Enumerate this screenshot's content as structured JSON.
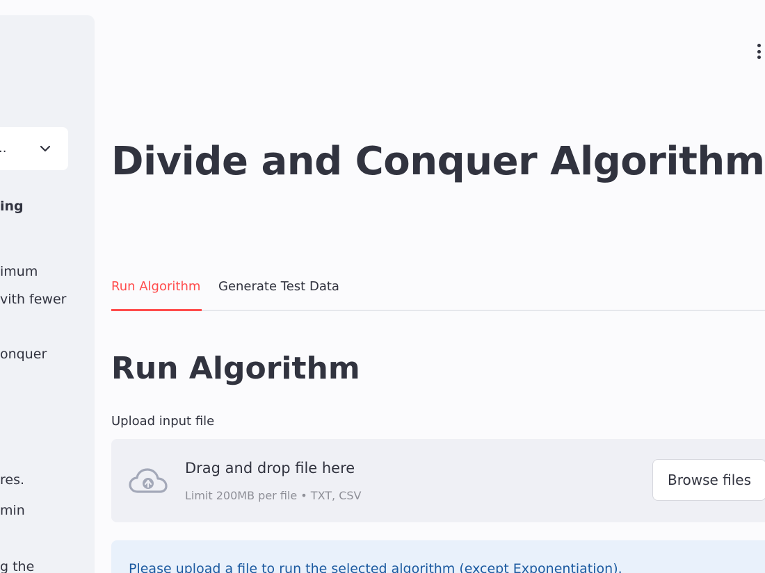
{
  "sidebar": {
    "select_value": "..",
    "fragments": [
      "ing",
      "imum",
      "vith fewer",
      "onquer",
      "res.",
      "min",
      "g the"
    ]
  },
  "header": {
    "menu_icon": "vertical-dots-icon"
  },
  "main": {
    "title": "Divide and Conquer Algorithms",
    "tabs": [
      {
        "label": "Run Algorithm",
        "active": true
      },
      {
        "label": "Generate Test Data",
        "active": false
      }
    ],
    "subheader": "Run Algorithm",
    "uploader": {
      "label": "Upload input file",
      "drag_text": "Drag and drop file here",
      "limit_text": "Limit 200MB per file • TXT, CSV",
      "browse_label": "Browse files",
      "icon": "cloud-upload-icon"
    },
    "info_text": "Please upload a file to run the selected algorithm (except Exponentiation)."
  },
  "colors": {
    "accent": "#ff4b4b",
    "text": "#31333f",
    "sidebar_bg": "#f0f2f6",
    "info_bg": "#e9f1fb",
    "info_text": "#1c5aa0"
  }
}
